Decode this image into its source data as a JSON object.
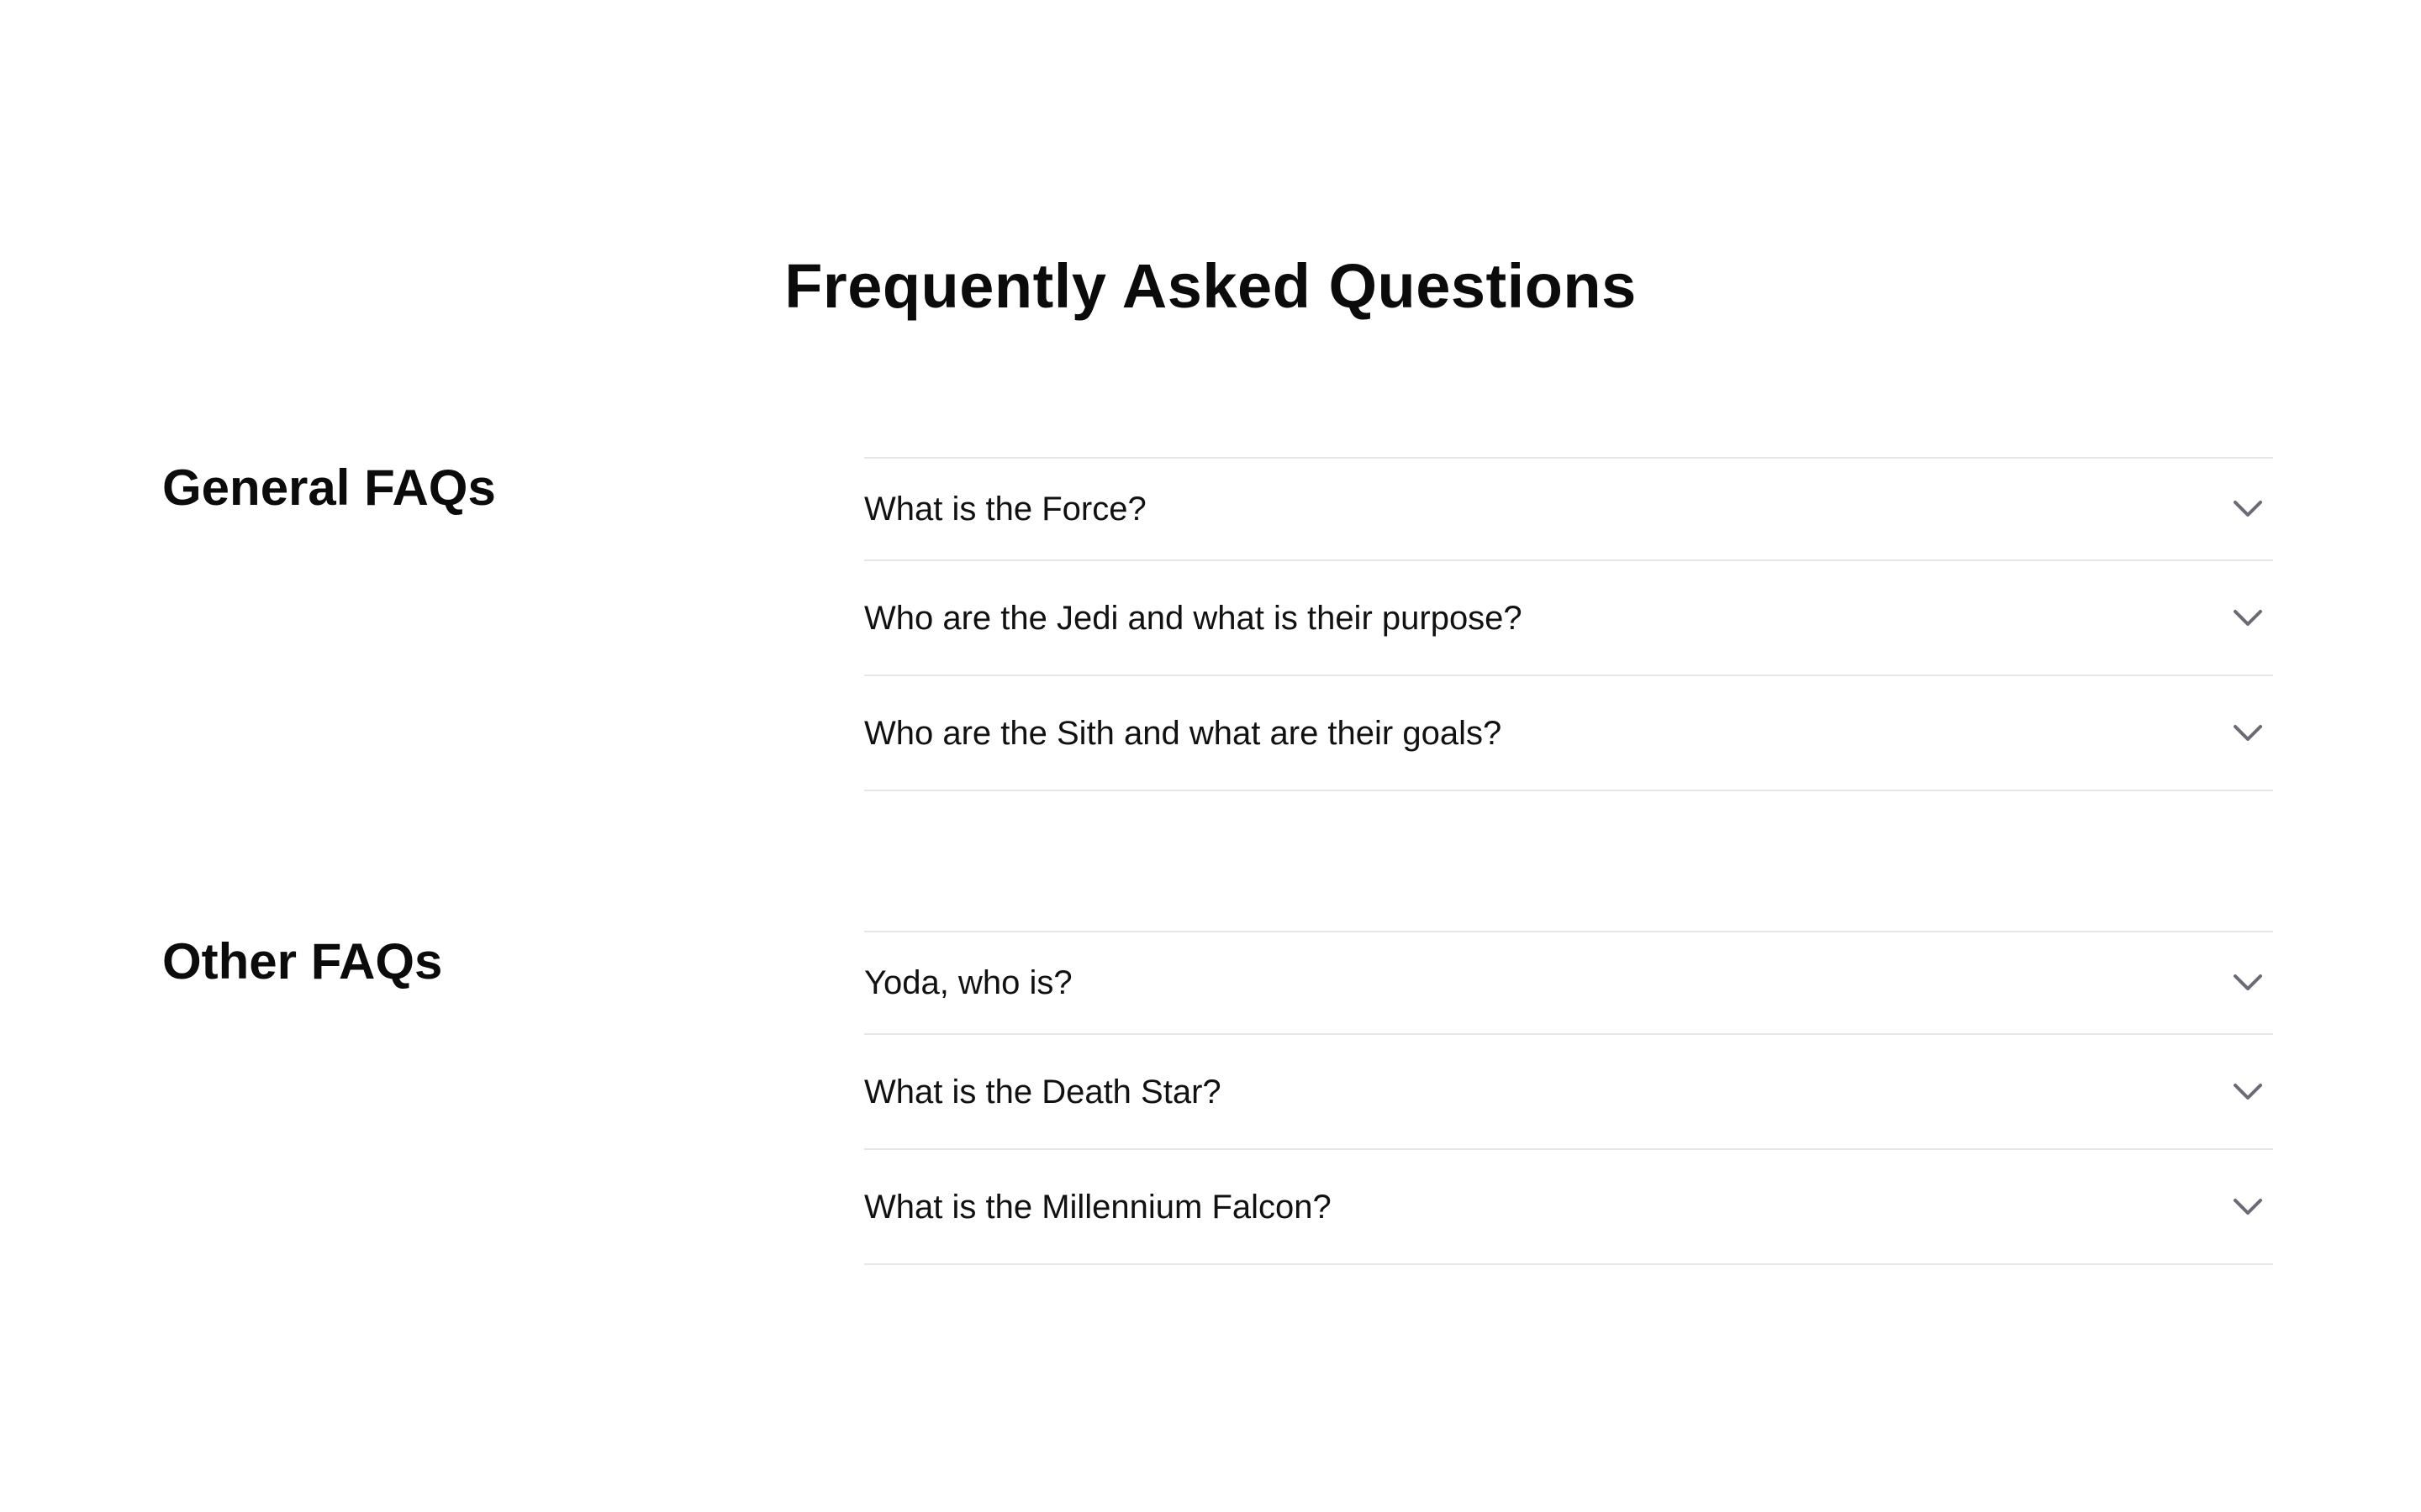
{
  "page": {
    "title": "Frequently Asked Questions"
  },
  "sections": [
    {
      "heading": "General FAQs",
      "items": [
        {
          "question": "What is the Force?"
        },
        {
          "question": "Who are the Jedi and what is their purpose?"
        },
        {
          "question": "Who are the Sith and what are their goals?"
        }
      ]
    },
    {
      "heading": "Other FAQs",
      "items": [
        {
          "question": "Yoda, who is?"
        },
        {
          "question": "What is the Death Star?"
        },
        {
          "question": "What is the Millennium Falcon?"
        }
      ]
    }
  ],
  "icons": {
    "expand": "chevron-down-icon"
  },
  "colors": {
    "text": "#0b0b0b",
    "divider": "#e6e6e6",
    "icon": "#6b6b75",
    "background": "#ffffff"
  }
}
